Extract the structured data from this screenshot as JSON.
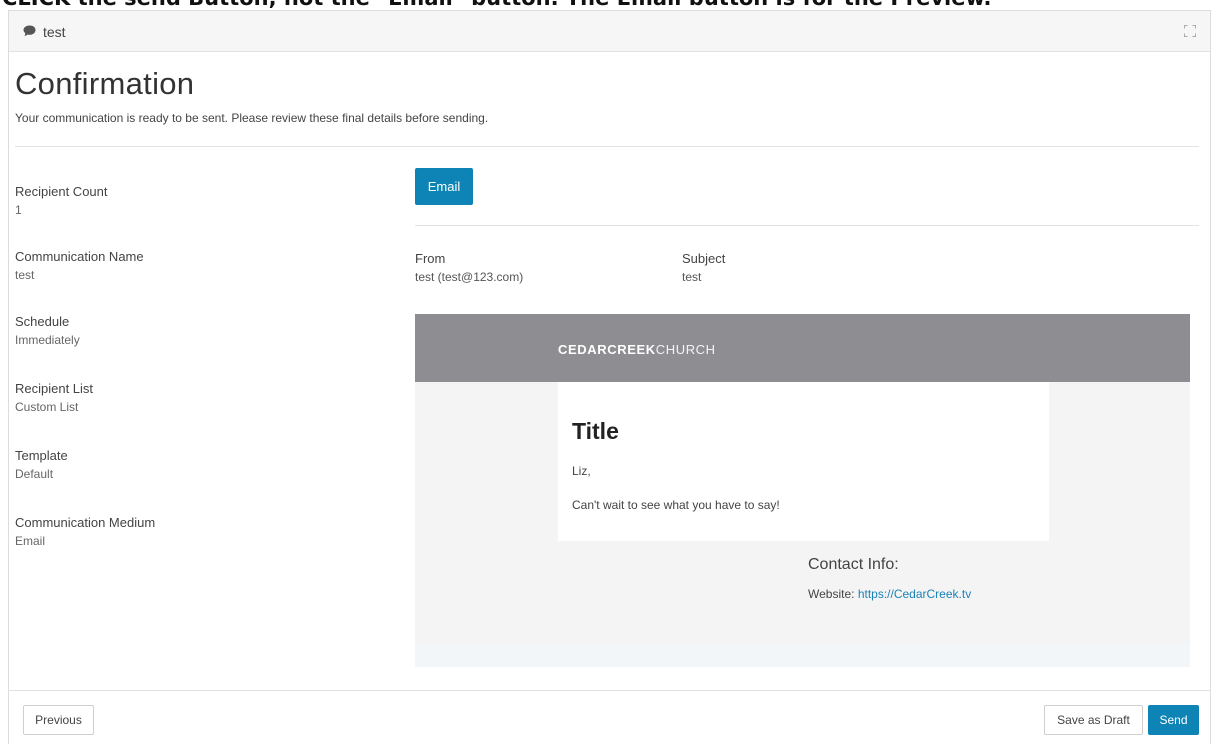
{
  "banner": "CLICK the send Button, not the \"Email\" button. The Email button is for the Preview.",
  "header": {
    "title": "test",
    "icon": "chat-bubble-icon",
    "expand_icon": "fullscreen-icon"
  },
  "page": {
    "title": "Confirmation",
    "description": "Your communication is ready to be sent. Please review these final details before sending."
  },
  "details": [
    {
      "label": "Recipient Count",
      "value": "1"
    },
    {
      "label": "Communication Name",
      "value": "test"
    },
    {
      "label": "Schedule",
      "value": "Immediately"
    },
    {
      "label": "Recipient List",
      "value": "Custom List"
    },
    {
      "label": "Template",
      "value": "Default"
    },
    {
      "label": "Communication Medium",
      "value": "Email"
    }
  ],
  "medium_button": "Email",
  "email_meta": {
    "from_label": "From",
    "from_value": "test (test@123.com)",
    "subject_label": "Subject",
    "subject_value": "test"
  },
  "preview": {
    "logo_bold": "CEDARCREEK",
    "logo_light": "CHURCH",
    "title": "Title",
    "greeting": "Liz,",
    "body": "Can't wait to see what you have to say!",
    "contact_heading": "Contact Info:",
    "website_label": "Website:",
    "website_url": "https://CedarCreek.tv"
  },
  "footer": {
    "previous": "Previous",
    "save_draft": "Save as Draft",
    "send": "Send"
  },
  "colors": {
    "primary": "#0d84b5",
    "preview_band": "#8e8d92",
    "link": "#1b82b8"
  }
}
